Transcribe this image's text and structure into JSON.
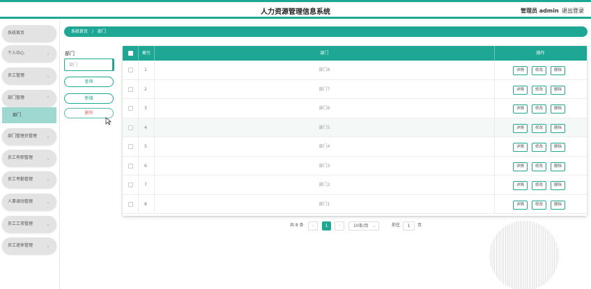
{
  "header": {
    "title": "人力资源管理信息系统",
    "admin": "管理员 admin",
    "logout": "退出登录"
  },
  "sidebar": {
    "items": [
      {
        "label": "系统首页"
      },
      {
        "label": "个人中心"
      },
      {
        "label": "员工管理"
      },
      {
        "label": "部门管理"
      },
      {
        "label": "部门管理员管理"
      },
      {
        "label": "员工有职管理"
      },
      {
        "label": "员工考勤管理"
      },
      {
        "label": "人事调动管理"
      },
      {
        "label": "员工工资管理"
      },
      {
        "label": "员工退休管理"
      }
    ],
    "subitem": "部门"
  },
  "breadcrumb": {
    "home": "系统首页",
    "separator": "/",
    "current": "部门"
  },
  "filter": {
    "label": "部门",
    "placeholder": "部门",
    "query_label": "查询",
    "add_label": "新增",
    "delete_label": "删除"
  },
  "table": {
    "col_index": "索引",
    "col_dept": "部门",
    "col_actions": "操作",
    "rows": [
      {
        "idx": "1",
        "dept": "部门8"
      },
      {
        "idx": "2",
        "dept": "部门7"
      },
      {
        "idx": "3",
        "dept": "部门6"
      },
      {
        "idx": "4",
        "dept": "部门5"
      },
      {
        "idx": "5",
        "dept": "部门4"
      },
      {
        "idx": "6",
        "dept": "部门3"
      },
      {
        "idx": "7",
        "dept": "部门2"
      },
      {
        "idx": "8",
        "dept": "部门1"
      }
    ],
    "actions": {
      "detail": "详情",
      "edit": "修改",
      "delete": "删除"
    }
  },
  "pager": {
    "total": "共 8 条",
    "prev": "‹",
    "page": "1",
    "next": "›",
    "page_size": "10条/页",
    "goto_label": "前往",
    "goto_value": "1",
    "page_unit": "页"
  },
  "colors": {
    "accent": "#1fa796",
    "submenu_active": "#9fd8d1"
  }
}
